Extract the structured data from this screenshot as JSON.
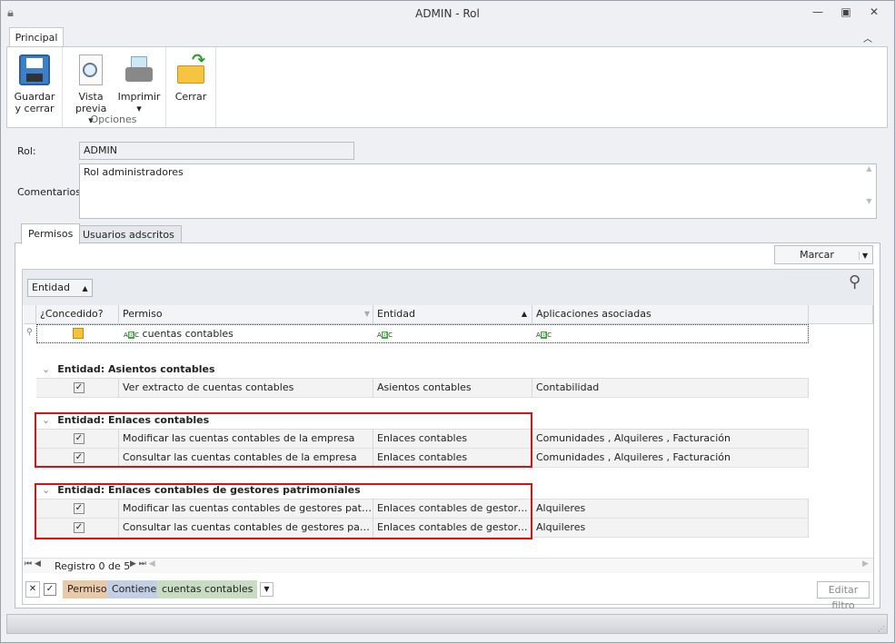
{
  "window": {
    "title": "ADMIN - Rol"
  },
  "ribbon": {
    "tab": "Principal",
    "buttons": {
      "save": "Guardar y cerrar",
      "preview": "Vista previa",
      "print": "Imprimir",
      "close": "Cerrar"
    },
    "group_label": "Opciones"
  },
  "form": {
    "rol_label": "Rol:",
    "rol_value": "ADMIN",
    "comments_label": "Comentarios:",
    "comments_value": "Rol administradores"
  },
  "tabs": [
    "Permisos",
    "Usuarios adscritos"
  ],
  "marcar": "Marcar",
  "group_by": "Entidad",
  "columns": [
    "¿Concedido?",
    "Permiso",
    "Entidad",
    "Aplicaciones  asociadas"
  ],
  "filter_row": {
    "permiso": "cuentas contables"
  },
  "groups": [
    {
      "title": "Entidad: Asientos contables",
      "rows": [
        {
          "checked": true,
          "permiso": "Ver extracto de cuentas contables",
          "entidad": "Asientos contables",
          "apps": "Contabilidad"
        }
      ]
    },
    {
      "title": "Entidad: Enlaces contables",
      "rows": [
        {
          "checked": true,
          "permiso": "Modificar las cuentas contables de la empresa",
          "entidad": "Enlaces contables",
          "apps": "Comunidades , Alquileres , Facturación"
        },
        {
          "checked": true,
          "permiso": "Consultar las cuentas contables de la empresa",
          "entidad": "Enlaces contables",
          "apps": "Comunidades , Alquileres , Facturación"
        }
      ]
    },
    {
      "title": "Entidad: Enlaces contables de gestores patrimoniales",
      "rows": [
        {
          "checked": true,
          "permiso": "Modificar las cuentas contables de gestores patrimoniales",
          "entidad": "Enlaces contables de gestores patrimoniales",
          "apps": "Alquileres"
        },
        {
          "checked": true,
          "permiso": "Consultar las cuentas contables de gestores patrimoniales",
          "entidad": "Enlaces contables de gestores patrimoniales",
          "apps": "Alquileres"
        }
      ]
    }
  ],
  "navigator": "Registro 0 de 5",
  "filter_panel": {
    "field": "Permiso",
    "op": "Contiene",
    "value": "cuentas contables",
    "edit": "Editar filtro"
  }
}
